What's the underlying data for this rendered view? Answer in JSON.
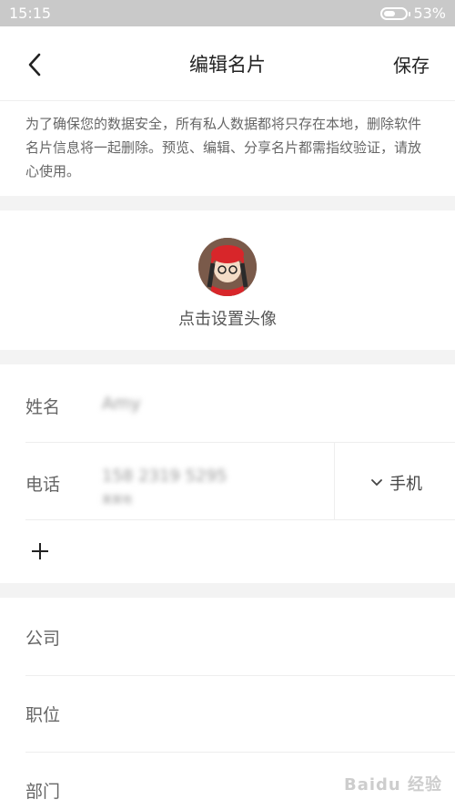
{
  "status_bar": {
    "time": "15:15",
    "battery_percent_label": "53%",
    "battery_level": 0.53
  },
  "header": {
    "title": "编辑名片",
    "save_label": "保存",
    "back_icon": "chevron-left-icon"
  },
  "notice": {
    "text": "为了确保您的数据安全，所有私人数据都将只存在本地，删除软件名片信息将一起删除。预览、编辑、分享名片都需指纹验证，请放心使用。"
  },
  "avatar": {
    "label": "点击设置头像"
  },
  "fields": {
    "name": {
      "label": "姓名",
      "value": "Amy"
    },
    "phone": {
      "label": "电话",
      "value": "158 2319 5295",
      "sub": "某某地",
      "type": "手机"
    }
  },
  "add_icon": "plus-icon",
  "extra_fields": {
    "company": {
      "label": "公司"
    },
    "position": {
      "label": "职位"
    },
    "department": {
      "label": "部门"
    }
  },
  "watermark": "Baidu 经验",
  "colors": {
    "status_bar": "#c9c9c9",
    "section_gap": "#f3f3f3",
    "divider": "#eeeeee"
  }
}
